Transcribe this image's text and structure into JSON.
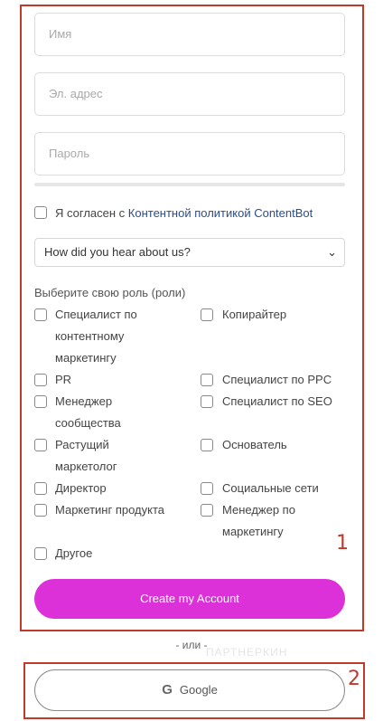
{
  "form": {
    "name_placeholder": "Имя",
    "email_placeholder": "Эл. адрес",
    "password_placeholder": "Пароль",
    "agree_prefix": "Я согласен с ",
    "agree_link": "Контентной политикой ContentBot",
    "select_value": "How did you hear about us?",
    "roles_title": "Выберите свою роль (роли)",
    "roles": [
      "Специалист по контентному маркетингу",
      "Копирайтер",
      "PR",
      "Специалист по PPC",
      "Менеджер сообщества",
      "Специалист по SEO",
      "Растущий маркетолог",
      "Основатель",
      "Директор",
      "Социальные сети",
      "Маркетинг продукта",
      "Менеджер по маркетингу",
      "Другое"
    ],
    "submit_label": "Create my Account"
  },
  "divider": {
    "or_text": "- или -"
  },
  "google": {
    "label": "Google",
    "g": "G"
  },
  "watermark": "ПАРТНЕРКИН",
  "annotations": {
    "one": "1",
    "two": "2"
  },
  "colors": {
    "accent": "#dc30d8",
    "annotation": "#c0392b",
    "link": "#2c4d8a"
  }
}
